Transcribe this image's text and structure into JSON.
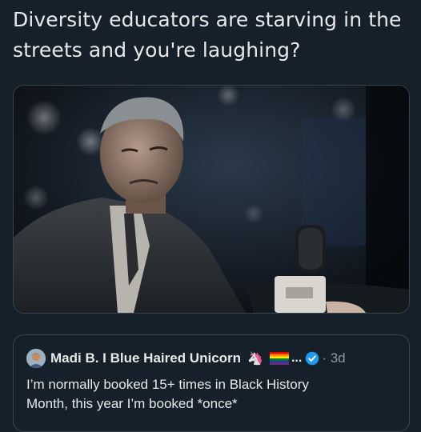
{
  "tweet": {
    "text_line1": "Diversity educators are starving in the",
    "text_line2": "streets and you're laughing?"
  },
  "quote": {
    "author_name": "Madi B. I Blue Haired Unicorn",
    "name_emoji": "🦄",
    "truncation": "...",
    "time": "· 3d",
    "body_line1": "I’m normally booked 15+ times in Black History",
    "body_line2": "Month, this year I’m booked *once*"
  },
  "colors": {
    "background": "#15202b",
    "border": "#38444d",
    "text": "#e7e9ea",
    "muted": "#8b98a5",
    "verified": "#1d9bf0"
  }
}
